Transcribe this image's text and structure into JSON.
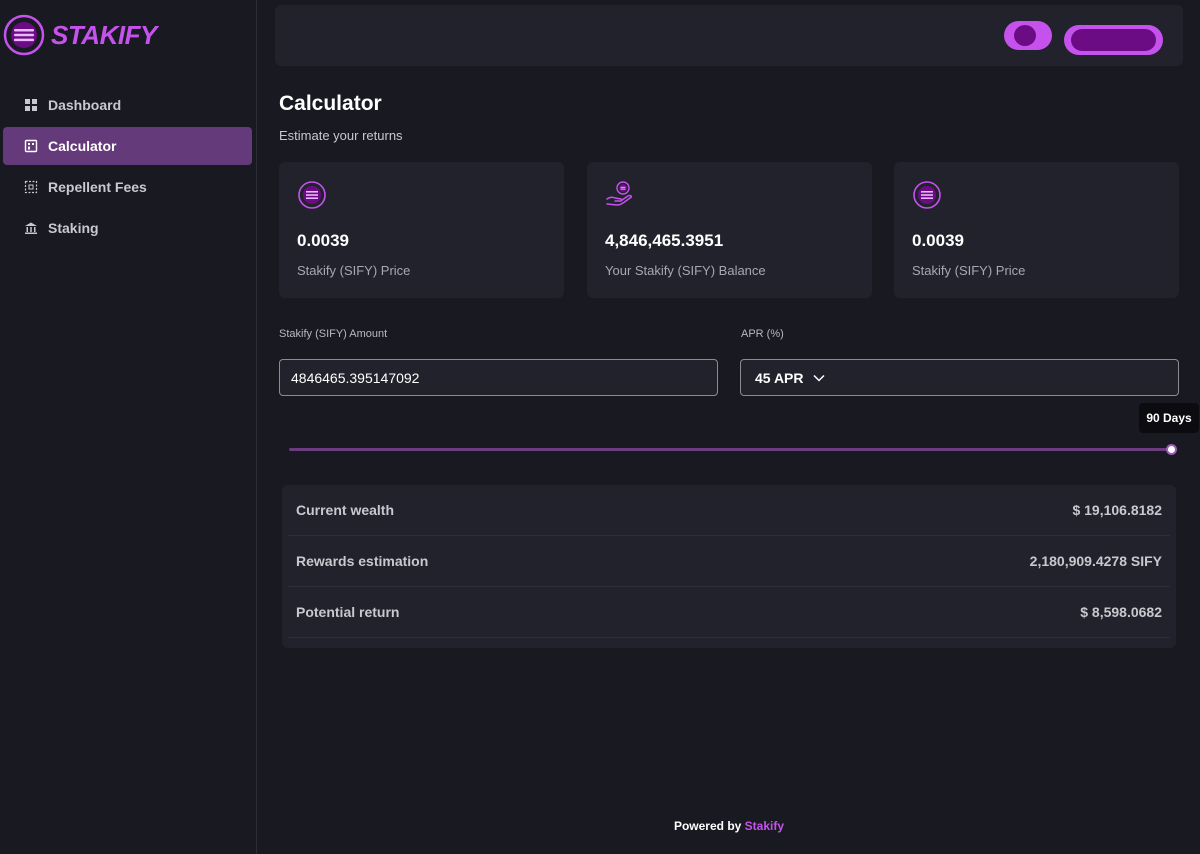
{
  "brand": {
    "name": "STAKIFY",
    "accent": "#c652ee",
    "logo_icon": "stakify-logo-icon"
  },
  "sidebar": {
    "items": [
      {
        "label": "Dashboard",
        "icon": "grid-icon",
        "active": false
      },
      {
        "label": "Calculator",
        "icon": "calculator-icon",
        "active": true
      },
      {
        "label": "Repellent Fees",
        "icon": "fees-icon",
        "active": false
      },
      {
        "label": "Staking",
        "icon": "bank-icon",
        "active": false
      }
    ]
  },
  "header": {
    "title": "Calculator",
    "subtitle": "Estimate your returns"
  },
  "cards": [
    {
      "value": "0.0039",
      "label": "Stakify (SIFY) Price",
      "icon": "stakify-coin-icon"
    },
    {
      "value": "4,846,465.3951",
      "label": "Your Stakify (SIFY) Balance",
      "icon": "hand-coin-icon"
    },
    {
      "value": "0.0039",
      "label": "Stakify (SIFY) Price",
      "icon": "stakify-coin-icon"
    }
  ],
  "form": {
    "amount_label": "Stakify (SIFY) Amount",
    "amount_value": "4846465.395147092",
    "apr_label": "APR (%)",
    "apr_value": "45 APR"
  },
  "slider": {
    "tooltip": "90 Days",
    "fraction": 1.0
  },
  "results": [
    {
      "label": "Current wealth",
      "value": "$ 19,106.8182"
    },
    {
      "label": "Rewards estimation",
      "value": "2,180,909.4278 SIFY"
    },
    {
      "label": "Potential return",
      "value": "$ 8,598.0682"
    }
  ],
  "footer": {
    "prefix": "Powered by",
    "brand": "Stakify"
  }
}
